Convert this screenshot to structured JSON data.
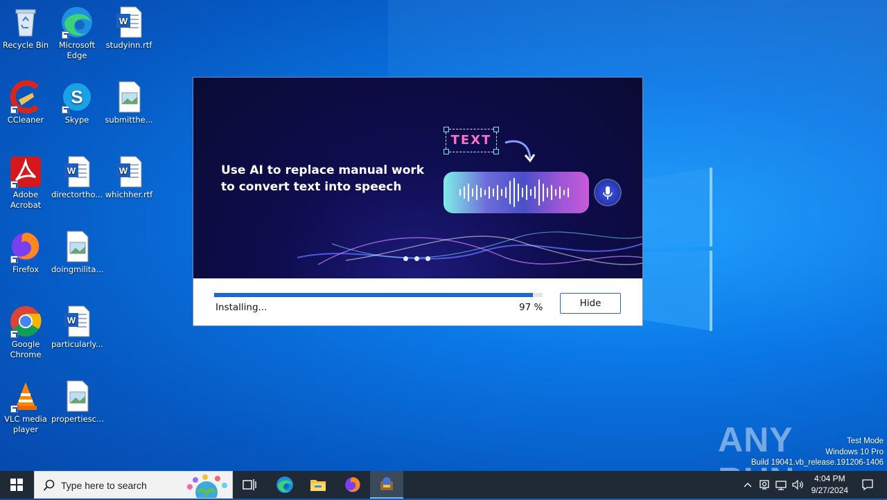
{
  "desktop": {
    "icons": [
      {
        "label": "Recycle Bin",
        "icon": "recycle-bin-icon"
      },
      {
        "label": "Microsoft Edge",
        "icon": "edge-icon"
      },
      {
        "label": "studyinn.rtf",
        "icon": "word-document-icon"
      },
      {
        "label": "CCleaner",
        "icon": "ccleaner-icon"
      },
      {
        "label": "Skype",
        "icon": "skype-icon"
      },
      {
        "label": "submitthe...",
        "icon": "image-file-icon"
      },
      {
        "label": "Adobe Acrobat",
        "icon": "acrobat-icon"
      },
      {
        "label": "directortho...",
        "icon": "word-document-icon"
      },
      {
        "label": "whichher.rtf",
        "icon": "word-document-icon"
      },
      {
        "label": "Firefox",
        "icon": "firefox-icon"
      },
      {
        "label": "doingmilita...",
        "icon": "image-file-icon"
      },
      {
        "label": "Google Chrome",
        "icon": "chrome-icon"
      },
      {
        "label": "particularly...",
        "icon": "word-document-icon"
      },
      {
        "label": "VLC media player",
        "icon": "vlc-icon"
      },
      {
        "label": "propertiesc...",
        "icon": "image-file-icon"
      }
    ]
  },
  "installer": {
    "headline": "Use AI to replace manual work to convert text into speech",
    "badge_text": "TEXT",
    "status": "Installing...",
    "progress_percent": 97,
    "percent_label": "97 %",
    "hide_label": "Hide"
  },
  "watermark": {
    "brand": "ANY RUN",
    "test_mode": "Test Mode",
    "edition": "Windows 10 Pro",
    "build": "Build 19041.vb_release.191206-1406"
  },
  "taskbar": {
    "search_placeholder": "Type here to search",
    "time": "4:04 PM",
    "date": "9/27/2024",
    "apps": [
      "task-view-icon",
      "edge-icon",
      "file-explorer-icon",
      "firefox-icon",
      "installer-app-icon"
    ]
  },
  "colors": {
    "accent": "#1a66d6",
    "taskbar": "#1f2a36",
    "banner": "#0e0d4e"
  }
}
